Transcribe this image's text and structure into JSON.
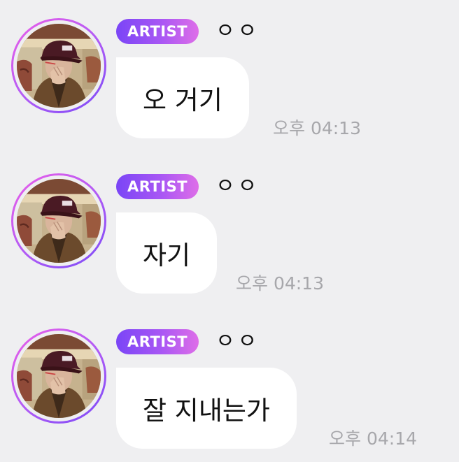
{
  "chat": {
    "messages": [
      {
        "badge": "ARTIST",
        "sender": "ㅇㅇ",
        "text": "오 거기",
        "time": "오후 04:13"
      },
      {
        "badge": "ARTIST",
        "sender": "ㅇㅇ",
        "text": "자기",
        "time": "오후 04:13"
      },
      {
        "badge": "ARTIST",
        "sender": "ㅇㅇ",
        "text": "잘 지내는가",
        "time": "오후 04:14"
      }
    ]
  },
  "colors": {
    "background": "#efeff1",
    "bubble": "#ffffff",
    "badge_gradient_start": "#7a45f6",
    "badge_gradient_end": "#de6ee8",
    "timestamp": "#a7a7ab"
  }
}
